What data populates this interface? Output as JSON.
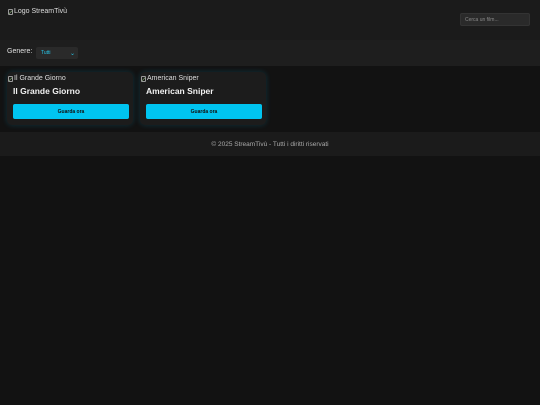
{
  "header": {
    "logo_alt": "Logo StreamTivù",
    "search_placeholder": "Cerca un film..."
  },
  "filter": {
    "genre_label": "Genere:",
    "selected_genre": "Tutti"
  },
  "movies": [
    {
      "image_alt": "Il Grande Giorno",
      "title": "Il Grande Giorno",
      "button_label": "Guarda ora"
    },
    {
      "image_alt": "American Sniper",
      "title": "American Sniper",
      "button_label": "Guarda ora"
    }
  ],
  "footer": {
    "text": "© 2025 StreamTivù - Tutti i diritti riservati"
  },
  "colors": {
    "accent": "#00c4f0",
    "background": "#121212"
  }
}
